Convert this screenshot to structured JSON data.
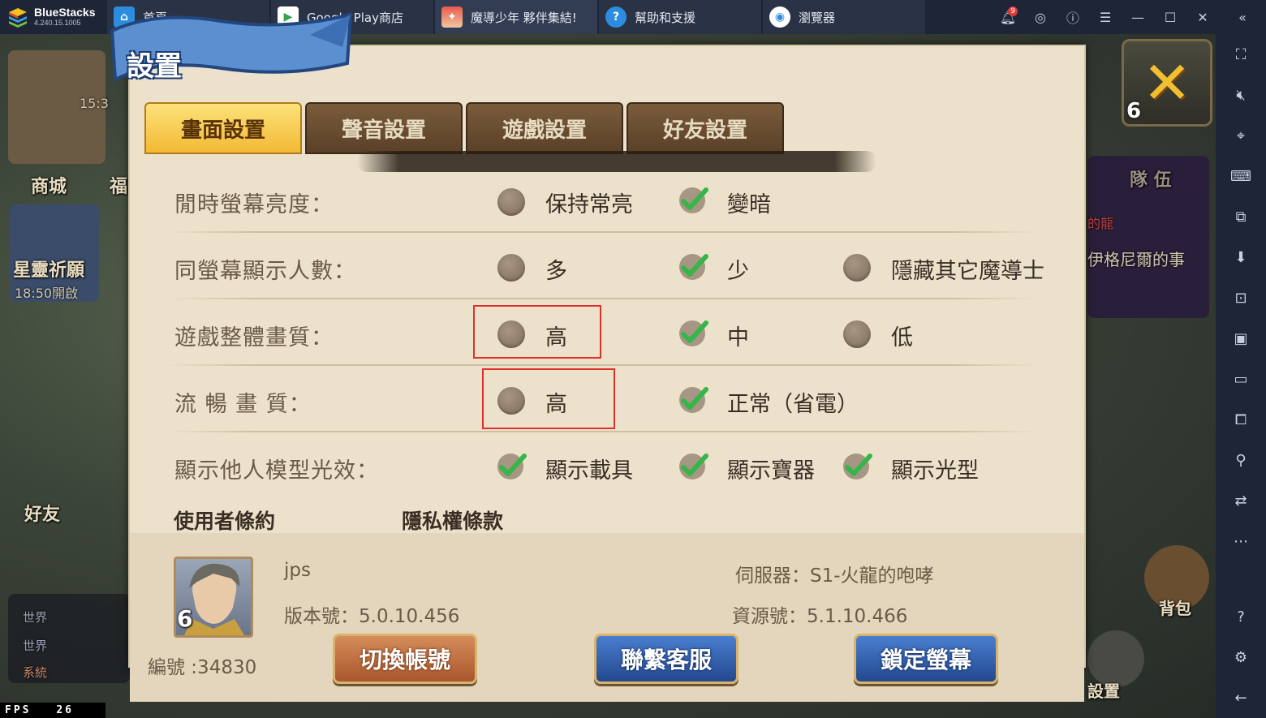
{
  "titlebar": {
    "brand_name": "BlueStacks",
    "brand_version": "4.240.15.1005",
    "tabs": [
      {
        "label": "首頁"
      },
      {
        "label": "Google Play商店"
      },
      {
        "label": "魔導少年 夥伴集結!"
      },
      {
        "label": "幫助和支援"
      },
      {
        "label": "瀏覽器"
      }
    ],
    "notification_count": "9"
  },
  "game_bg": {
    "clock": "15:3",
    "shop": "商城",
    "fu": "福",
    "star_wish": "星靈祈願",
    "star_time": "18:50開啟",
    "friends": "好友",
    "team": "隊 伍",
    "de_long": "的龍",
    "quest": "伊格尼爾的事",
    "chat_world1": "世界",
    "chat_world2": "世界",
    "chat_system": "系統",
    "bag": "背包",
    "settings": "設置"
  },
  "panel": {
    "banner": "設置",
    "close_level": "6",
    "tabs": [
      {
        "label": "畫面設置"
      },
      {
        "label": "聲音設置"
      },
      {
        "label": "遊戲設置"
      },
      {
        "label": "好友設置"
      }
    ],
    "rows": {
      "idle_brightness": {
        "label": "閒時螢幕亮度：",
        "opt1": "保持常亮",
        "opt2": "變暗"
      },
      "same_screen": {
        "label": "同螢幕顯示人數：",
        "opt1": "多",
        "opt2": "少",
        "opt3": "隱藏其它魔導士"
      },
      "overall_quality": {
        "label": "遊戲整體畫質：",
        "opt1": "高",
        "opt2": "中",
        "opt3": "低"
      },
      "smooth_quality": {
        "label": "流 暢 畫 質：",
        "opt1": "高",
        "opt2": "正常（省電）"
      },
      "model_effects": {
        "label": "顯示他人模型光效：",
        "opt1": "顯示載具",
        "opt2": "顯示寶器",
        "opt3": "顯示光型"
      }
    },
    "links": {
      "terms": "使用者條約",
      "privacy": "隱私權條款"
    },
    "footer": {
      "avatar_level": "6",
      "player_name": "jps",
      "version": "版本號：5.0.10.456",
      "player_id": "編號 :34830",
      "server": "伺服器：S1-火龍的咆哮",
      "resource": "資源號：5.1.10.466",
      "switch_account": "切換帳號",
      "contact_support": "聯繫客服",
      "lock_screen": "鎖定螢幕"
    }
  },
  "fps": {
    "label": "FPS",
    "value": "26"
  },
  "colors": {
    "accent_gold": "#f2b934",
    "check_green": "#38b54a",
    "highlight_red": "#e0302a"
  }
}
